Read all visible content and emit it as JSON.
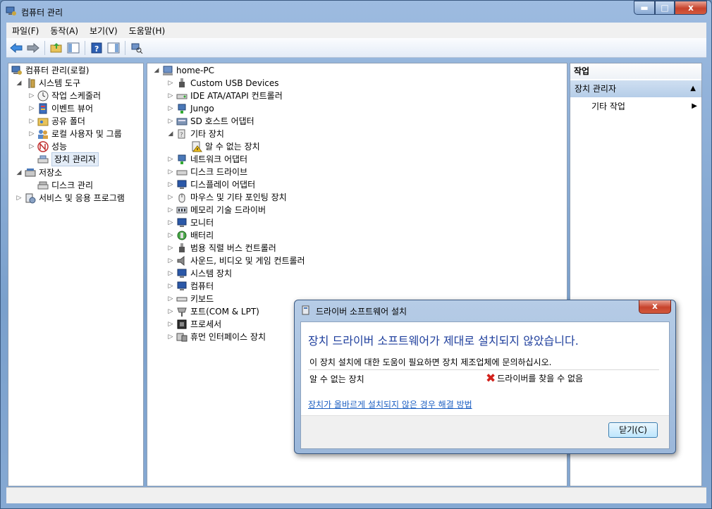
{
  "window": {
    "title": "컴퓨터 관리"
  },
  "menu": [
    "파일(F)",
    "동작(A)",
    "보기(V)",
    "도움말(H)"
  ],
  "left_tree": [
    {
      "label": "컴퓨터 관리(로컬)",
      "icon": "computer-management-icon"
    },
    {
      "label": "시스템 도구",
      "icon": "system-tools-icon"
    },
    {
      "label": "작업 스케줄러",
      "icon": "clock-icon"
    },
    {
      "label": "이벤트 뷰어",
      "icon": "event-viewer-icon"
    },
    {
      "label": "공유 폴더",
      "icon": "shared-folder-icon"
    },
    {
      "label": "로컬 사용자 및 그룹",
      "icon": "users-icon"
    },
    {
      "label": "성능",
      "icon": "performance-icon"
    },
    {
      "label": "장치 관리자",
      "icon": "device-manager-icon",
      "selected": true
    },
    {
      "label": "저장소",
      "icon": "storage-icon"
    },
    {
      "label": "디스크 관리",
      "icon": "disk-management-icon"
    },
    {
      "label": "서비스 및 응용 프로그램",
      "icon": "services-icon"
    }
  ],
  "device_tree": {
    "root": "home-PC",
    "items": [
      "Custom USB Devices",
      "IDE ATA/ATAPI 컨트롤러",
      "Jungo",
      "SD 호스트 어댑터",
      "기타 장치",
      "알 수 없는 장치",
      "네트워크 어댑터",
      "디스크 드라이브",
      "디스플레이 어댑터",
      "마우스 및 기타 포인팅 장치",
      "메모리 기술 드라이버",
      "모니터",
      "배터리",
      "범용 직렬 버스 컨트롤러",
      "사운드, 비디오 및 게임 컨트롤러",
      "시스템 장치",
      "컴퓨터",
      "키보드",
      "포트(COM & LPT)",
      "프로세서",
      "휴먼 인터페이스 장치"
    ]
  },
  "actions": {
    "header": "작업",
    "section": "장치 관리자",
    "item": "기타 작업"
  },
  "dialog": {
    "title": "드라이버 소프트웨어 설치",
    "heading": "장치 드라이버 소프트웨어가 제대로 설치되지 않았습니다.",
    "message": "이 장치 설치에 대한 도움이 필요하면 장치 제조업체에 문의하십시오.",
    "device": "알 수 없는 장치",
    "status": "드라이버를 찾을 수 없음",
    "link": "장치가 올바르게 설치되지 않은 경우 해결 방법",
    "close_button": "닫기(C)",
    "close_glyph": "x"
  },
  "caption": {
    "minimize": "▬",
    "maximize": "□",
    "close": "x"
  }
}
